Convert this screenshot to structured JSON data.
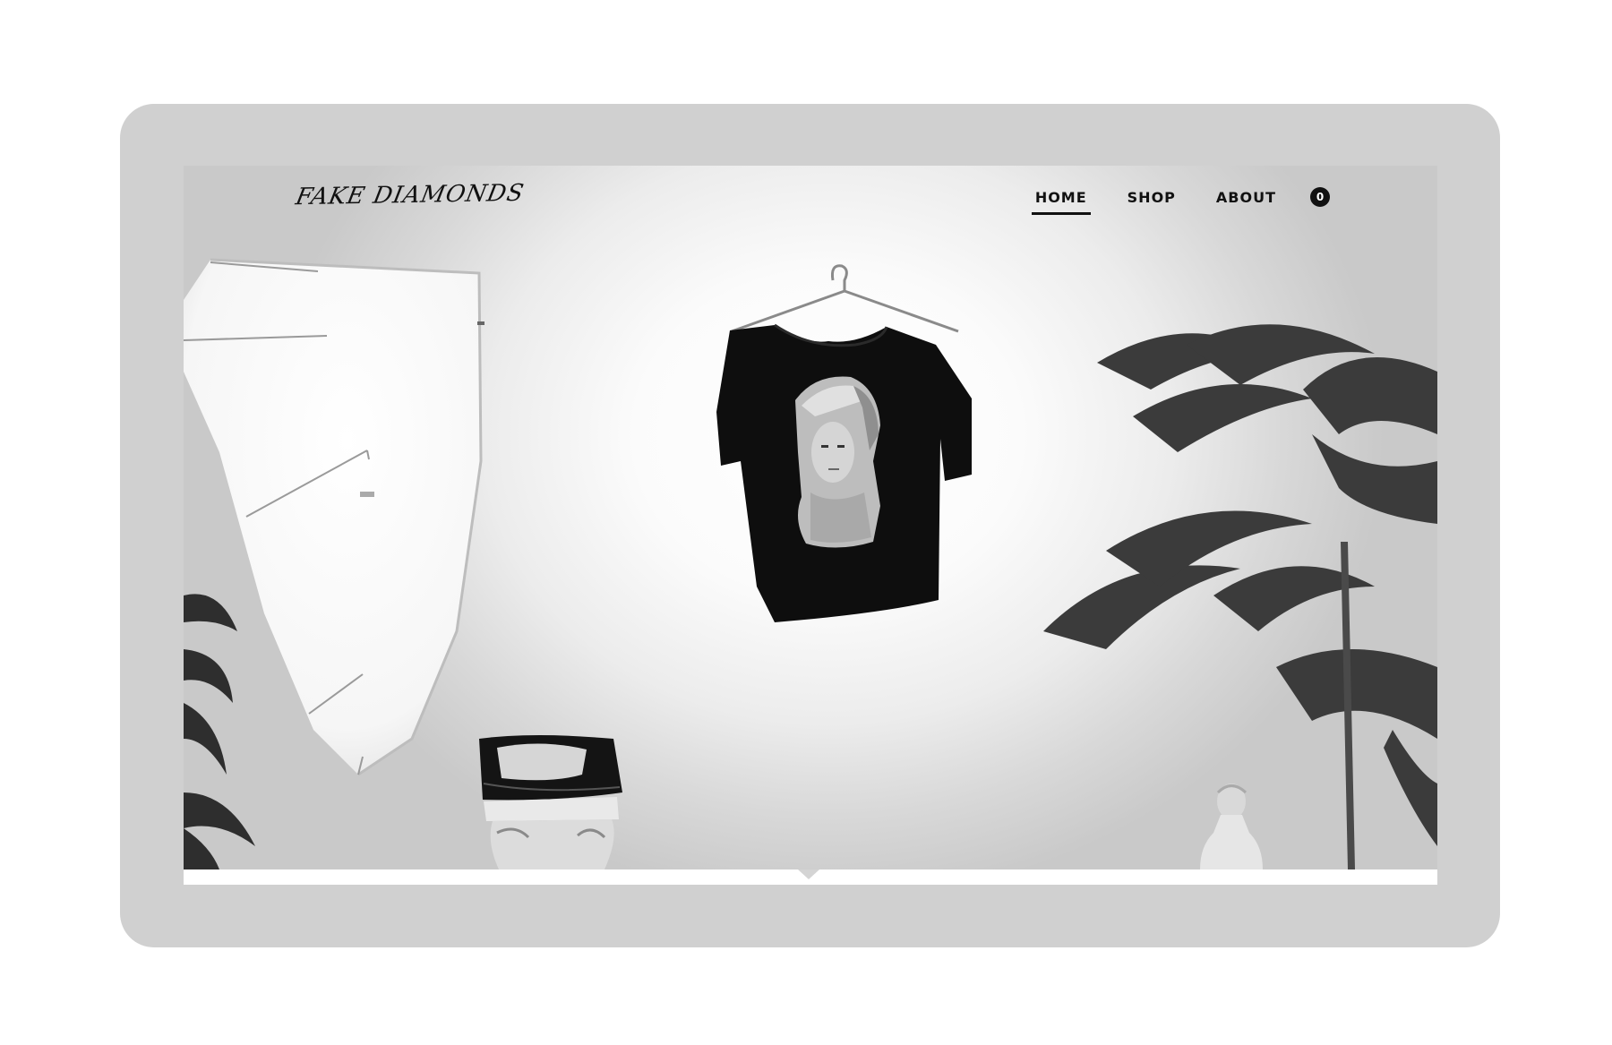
{
  "brand": {
    "logo_text": "FAKE DIAMONDS"
  },
  "nav": {
    "items": [
      {
        "label": "HOME",
        "active": true
      },
      {
        "label": "SHOP",
        "active": false
      },
      {
        "label": "ABOUT",
        "active": false
      }
    ],
    "cart_count": "0"
  },
  "hero": {
    "image": "black-and-white-photo-tshirt-on-hanger"
  },
  "colors": {
    "device_frame": "#d0d0d0",
    "text": "#111111",
    "background": "#ffffff"
  }
}
